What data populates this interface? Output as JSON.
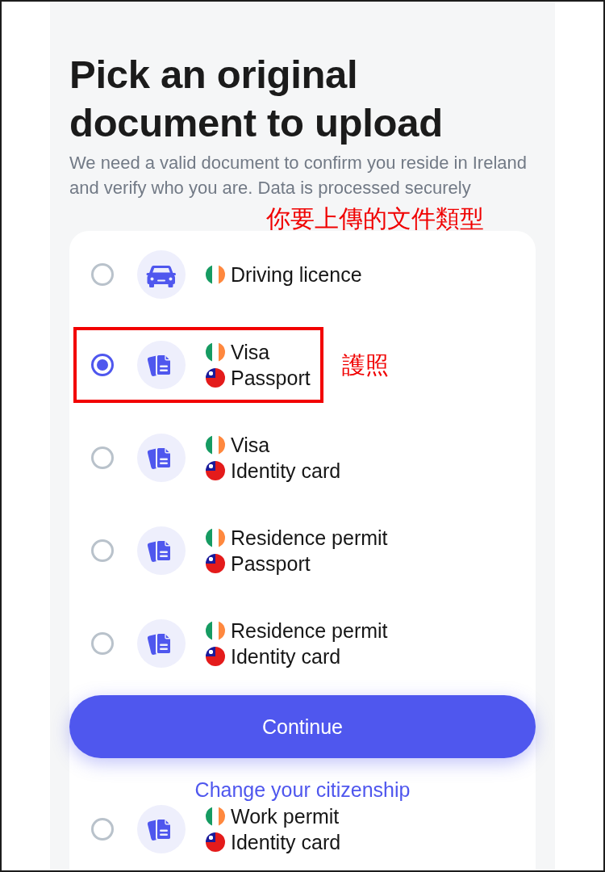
{
  "heading": "Pick an original document to upload",
  "subtitle": "We need a valid document to confirm you reside in Ireland and verify who you are. Data is processed securely",
  "annotation": "你要上傳的文件類型",
  "options": [
    {
      "kind": "car",
      "selected": false,
      "highlighted": false,
      "lines": [
        {
          "kind": "ireland",
          "text": "Driving licence"
        }
      ]
    },
    {
      "kind": "documents",
      "selected": true,
      "highlighted": true,
      "note": "護照",
      "lines": [
        {
          "kind": "ireland",
          "text": "Visa"
        },
        {
          "kind": "taiwan",
          "text": "Passport"
        }
      ]
    },
    {
      "kind": "documents",
      "selected": false,
      "highlighted": false,
      "lines": [
        {
          "kind": "ireland",
          "text": "Visa"
        },
        {
          "kind": "taiwan",
          "text": "Identity card"
        }
      ]
    },
    {
      "kind": "documents",
      "selected": false,
      "highlighted": false,
      "lines": [
        {
          "kind": "ireland",
          "text": "Residence permit"
        },
        {
          "kind": "taiwan",
          "text": "Passport"
        }
      ]
    },
    {
      "kind": "documents",
      "selected": false,
      "highlighted": false,
      "lines": [
        {
          "kind": "ireland",
          "text": "Residence permit"
        },
        {
          "kind": "taiwan",
          "text": "Identity card"
        }
      ]
    },
    {
      "kind": "documents",
      "selected": false,
      "highlighted": false,
      "lines": [
        {
          "kind": "ireland",
          "text": "Work permit"
        },
        {
          "kind": "taiwan",
          "text": "Identity card"
        }
      ]
    }
  ],
  "continue_button": "Continue",
  "change_citizenship_link": "Change your citizenship"
}
